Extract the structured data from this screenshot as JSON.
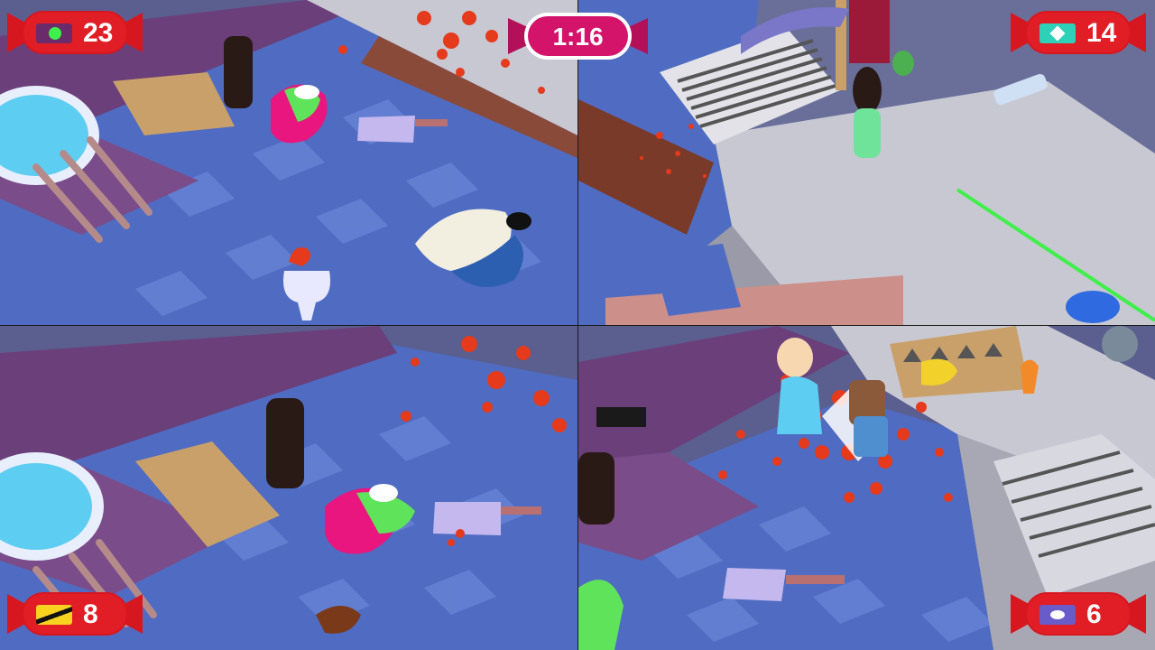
{
  "hud": {
    "timer": "1:16",
    "players": [
      {
        "id": "p1",
        "score": "23",
        "icon": "green-banner-icon",
        "color": "#d7171f"
      },
      {
        "id": "p2",
        "score": "14",
        "icon": "teal-banner-icon",
        "color": "#d7171f"
      },
      {
        "id": "p3",
        "score": "8",
        "icon": "yellow-black-banner-icon",
        "color": "#d7171f"
      },
      {
        "id": "p4",
        "score": "6",
        "icon": "purple-banner-icon",
        "color": "#d7171f"
      }
    ],
    "timer_color": "#d4136a"
  }
}
